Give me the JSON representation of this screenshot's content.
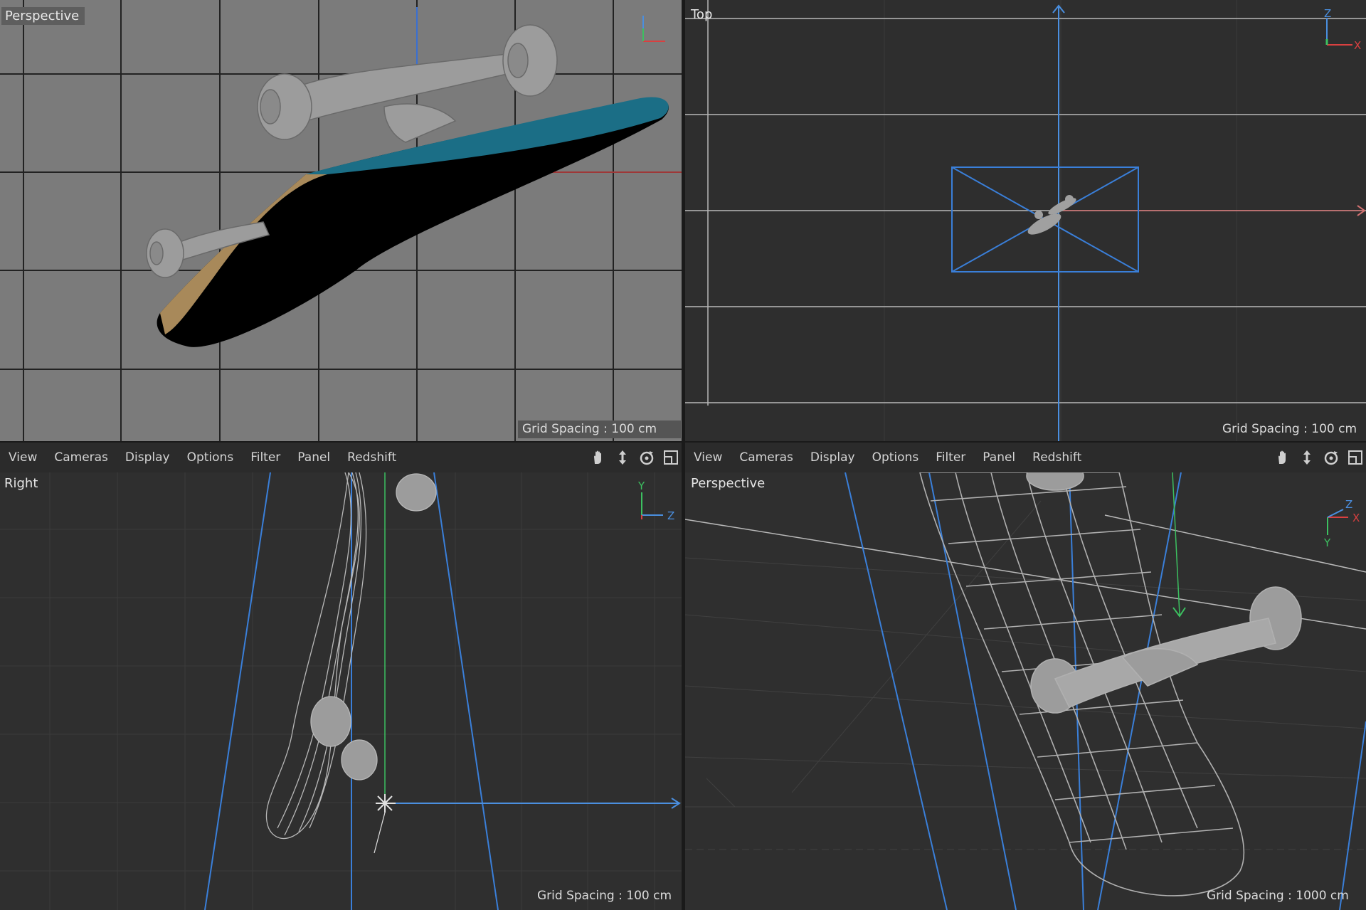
{
  "viewports": {
    "top_left": {
      "label": "Perspective",
      "grid_spacing": "Grid Spacing : 100 cm"
    },
    "top_right": {
      "label": "Top",
      "grid_spacing": "Grid Spacing : 100 cm"
    },
    "bottom_left": {
      "label": "Right",
      "grid_spacing": "Grid Spacing : 100 cm"
    },
    "bottom_right": {
      "label": "Perspective",
      "grid_spacing": "Grid Spacing : 1000 cm"
    }
  },
  "menu": {
    "view": "View",
    "cameras": "Cameras",
    "display": "Display",
    "options": "Options",
    "filter": "Filter",
    "panel": "Panel",
    "redshift": "Redshift"
  },
  "axes": {
    "x": "X",
    "y": "Y",
    "z": "Z"
  },
  "icons": [
    "pan-hand-icon",
    "move-arrows-icon",
    "rotate-orbit-icon",
    "maximize-viewport-icon"
  ],
  "colors": {
    "viewport_bg_shaded": "#7a7a7a",
    "viewport_bg_dark": "#2f2f2f",
    "selection_blue": "#3a7fd9",
    "axis_x": "#d94040",
    "axis_y": "#3cc060",
    "axis_z": "#4a8fe0",
    "deck_teal": "#1b6e86"
  }
}
